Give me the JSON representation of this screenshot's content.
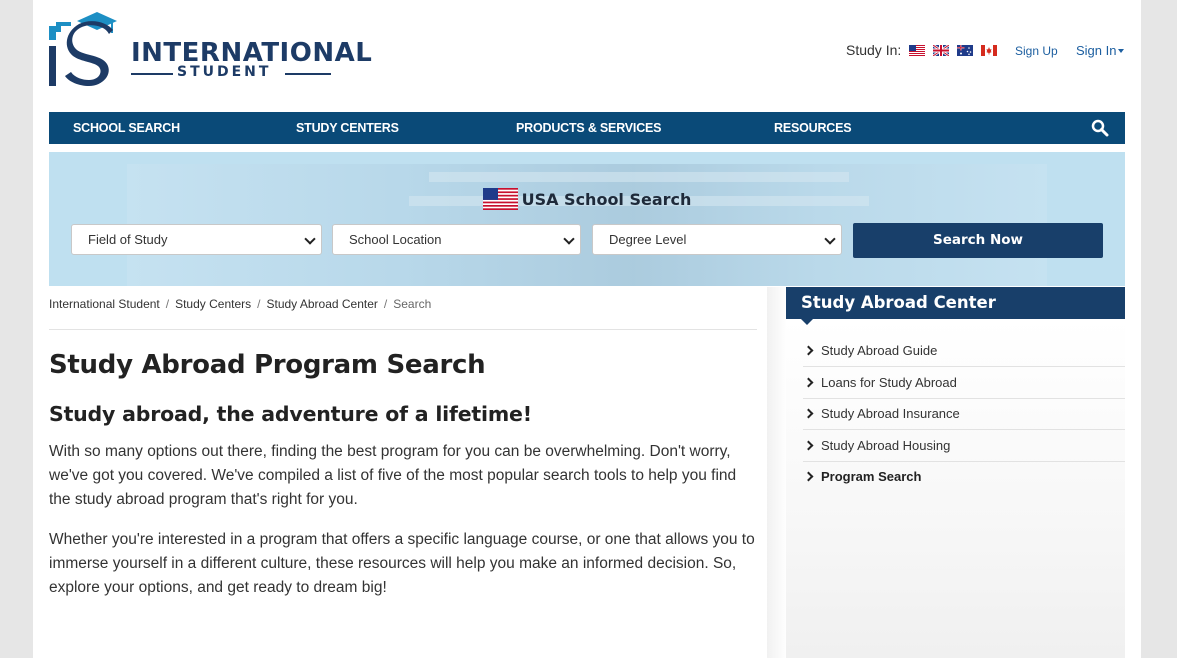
{
  "header": {
    "logo_word1": "INTERNATIONAL",
    "logo_word2": "STUDENT",
    "logo_initials": "IS",
    "study_in_label": "Study In:",
    "flags": [
      "us-flag",
      "uk-flag",
      "au-flag",
      "ca-flag"
    ],
    "signup_label": "Sign Up",
    "signin_label": "Sign In"
  },
  "nav": {
    "items": [
      "SCHOOL SEARCH",
      "STUDY CENTERS",
      "PRODUCTS & SERVICES",
      "RESOURCES"
    ],
    "search_icon": "search-icon"
  },
  "hero": {
    "title": "USA School Search",
    "field_select": "Field of Study",
    "location_select": "School Location",
    "degree_select": "Degree Level",
    "button_label": "Search Now"
  },
  "breadcrumb": [
    "International Student",
    "Study Centers",
    "Study Abroad Center",
    "Search"
  ],
  "main": {
    "title": "Study Abroad Program Search",
    "subtitle": "Study abroad, the adventure of a lifetime!",
    "para1": "With so many options out there, finding the best program for you can be overwhelming. Don't worry, we've got you covered. We've compiled a list of five of the most popular search tools to help you find the study abroad program that's right for you.",
    "para2": "Whether you're interested in a program that offers a specific language course, or one that allows you to immerse yourself in a different culture, these resources will help you make an informed decision. So, explore your options, and get ready to dream big!"
  },
  "sidebar": {
    "title": "Study Abroad Center",
    "items": [
      "Study Abroad Guide",
      "Loans for Study Abroad",
      "Study Abroad Insurance",
      "Study Abroad Housing",
      "Program Search"
    ]
  },
  "colors": {
    "nav_bg": "#0a4a78",
    "button_bg": "#183f6a",
    "link": "#1d5fa0",
    "hero_bg": "#bfe0f0"
  }
}
